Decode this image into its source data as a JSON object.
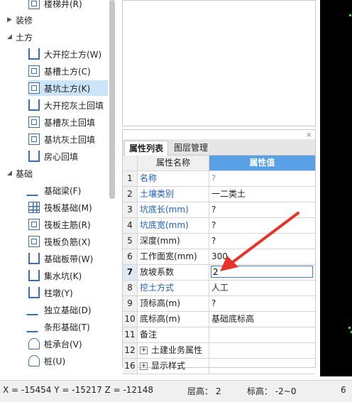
{
  "tree": {
    "top_item": "楼梯井(R)",
    "sections": [
      {
        "label": "装修",
        "arrow": "▶"
      },
      {
        "label": "土方",
        "arrow": "◢"
      },
      {
        "label": "基础",
        "arrow": "◢"
      }
    ],
    "earth_items": [
      {
        "label": "大开挖土方(W)",
        "icon": "pit-icon"
      },
      {
        "label": "基槽土方(C)",
        "icon": "trench-icon"
      },
      {
        "label": "基坑土方(K)",
        "icon": "foundation-pit-icon"
      },
      {
        "label": "大开挖灰土回填",
        "icon": "lime-backfill-icon"
      },
      {
        "label": "基槽灰土回填",
        "icon": "trench-backfill-icon"
      },
      {
        "label": "基坑灰土回填",
        "icon": "pit-backfill-icon"
      },
      {
        "label": "房心回填",
        "icon": "room-backfill-icon"
      }
    ],
    "foundation_items": [
      {
        "label": "基础梁(F)",
        "icon": "beam-icon"
      },
      {
        "label": "筏板基础(M)",
        "icon": "raft-icon"
      },
      {
        "label": "筏板主筋(R)",
        "icon": "raft-rebar-icon"
      },
      {
        "label": "筏板负筋(X)",
        "icon": "raft-neg-rebar-icon"
      },
      {
        "label": "基础板带(W)",
        "icon": "slab-strip-icon"
      },
      {
        "label": "集水坑(K)",
        "icon": "sump-icon"
      },
      {
        "label": "柱墩(Y)",
        "icon": "pier-icon"
      },
      {
        "label": "独立基础(D)",
        "icon": "isolated-footing-icon"
      },
      {
        "label": "条形基础(T)",
        "icon": "strip-footing-icon"
      },
      {
        "label": "桩承台(V)",
        "icon": "pile-cap-icon"
      },
      {
        "label": "桩(U)",
        "icon": "pile-icon"
      }
    ],
    "selected": "基坑土方(K)"
  },
  "props": {
    "close": "×",
    "tabs": [
      "属性列表",
      "图层管理"
    ],
    "header": {
      "name": "属性名称",
      "value": "属性值"
    },
    "rows": [
      {
        "num": "1",
        "name": "名称",
        "value": "?",
        "name_blue": true,
        "value_grey": true
      },
      {
        "num": "2",
        "name": "土壤类别",
        "value": "一二类土",
        "name_blue": true
      },
      {
        "num": "3",
        "name": "坑底长(mm)",
        "value": "?",
        "name_blue": true
      },
      {
        "num": "4",
        "name": "坑底宽(mm)",
        "value": "?",
        "name_blue": true
      },
      {
        "num": "5",
        "name": "深度(mm)",
        "value": "?"
      },
      {
        "num": "6",
        "name": "工作面宽(mm)",
        "value": "300"
      },
      {
        "num": "7",
        "name": "放坡系数",
        "value": "2",
        "active": true
      },
      {
        "num": "8",
        "name": "挖土方式",
        "value": "人工",
        "name_blue": true
      },
      {
        "num": "9",
        "name": "顶标高(m)",
        "value": "?"
      },
      {
        "num": "10",
        "name": "底标高(m)",
        "value": "基础底标高"
      },
      {
        "num": "11",
        "name": "备注",
        "value": ""
      },
      {
        "num": "12",
        "name": "土建业务属性",
        "value": "",
        "expander": "+"
      },
      {
        "num": "16",
        "name": "显示样式",
        "value": "",
        "expander": "+"
      }
    ]
  },
  "status": {
    "coords": "X = -15454 Y = -15217 Z = -12148",
    "floor_height": "层高： 2",
    "elevation": "标高： -2~0",
    "extra": "6"
  },
  "colors": {
    "accent": "#5aa0e6",
    "arrow": "#e8332a",
    "canvas": "#000000"
  }
}
